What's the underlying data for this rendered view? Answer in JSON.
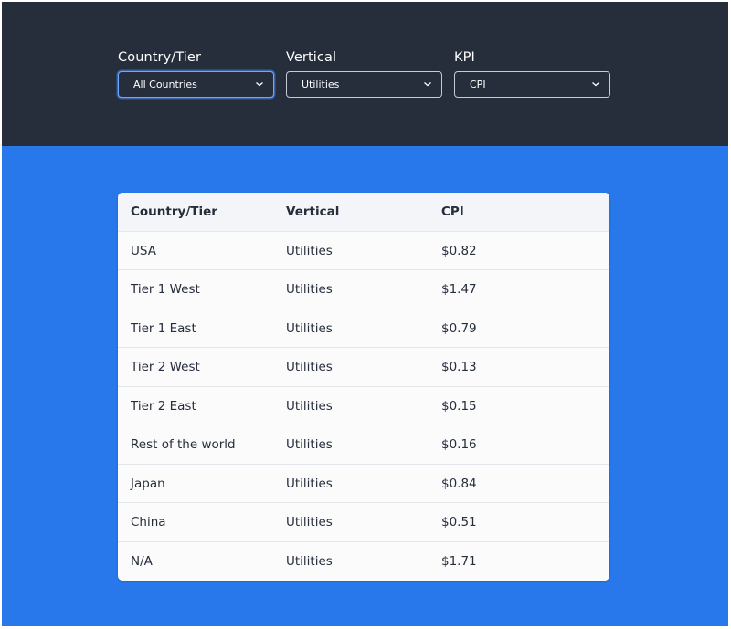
{
  "filters": {
    "country": {
      "label": "Country/Tier",
      "value": "All Countries"
    },
    "vertical": {
      "label": "Vertical",
      "value": "Utilities"
    },
    "kpi": {
      "label": "KPI",
      "value": "CPI"
    }
  },
  "table": {
    "headers": [
      "Country/Tier",
      "Vertical",
      "CPI"
    ],
    "rows": [
      [
        "USA",
        "Utilities",
        "$0.82"
      ],
      [
        "Tier 1 West",
        "Utilities",
        "$1.47"
      ],
      [
        "Tier 1 East",
        "Utilities",
        "$0.79"
      ],
      [
        "Tier 2 West",
        "Utilities",
        "$0.13"
      ],
      [
        "Tier 2 East",
        "Utilities",
        "$0.15"
      ],
      [
        "Rest of the world",
        "Utilities",
        "$0.16"
      ],
      [
        "Japan",
        "Utilities",
        "$0.84"
      ],
      [
        "China",
        "Utilities",
        "$0.51"
      ],
      [
        "N/A",
        "Utilities",
        "$1.71"
      ]
    ]
  },
  "colors": {
    "header_bg": "#262d3b",
    "main_bg": "#2878eb",
    "focus_ring": "#6ea8ff"
  }
}
